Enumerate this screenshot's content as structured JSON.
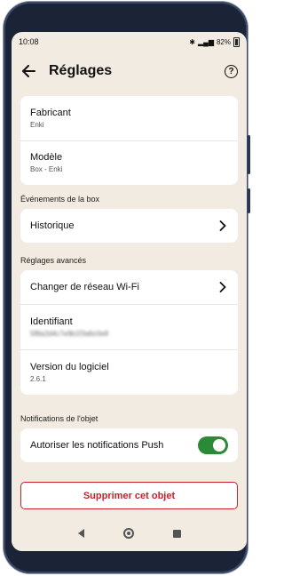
{
  "statusbar": {
    "time": "10:08",
    "battery": "82%"
  },
  "header": {
    "title": "Réglages",
    "help_label": "?"
  },
  "device_card": {
    "manufacturer_label": "Fabricant",
    "manufacturer_value": "Enki",
    "model_label": "Modèle",
    "model_value": "Box - Enki"
  },
  "events_section": {
    "title": "Événements de la box",
    "history_label": "Historique"
  },
  "advanced_section": {
    "title": "Réglages avancés",
    "wifi_label": "Changer de réseau Wi-Fi",
    "identifier_label": "Identifiant",
    "identifier_value": "5f8a2d4c7e9b1f3a6c0e8",
    "software_label": "Version du logiciel",
    "software_value": "2.6.1"
  },
  "notifications_section": {
    "title": "Notifications de l'objet",
    "push_label": "Autoriser les notifications Push",
    "push_enabled": true
  },
  "actions": {
    "delete_label": "Supprimer cet objet"
  },
  "colors": {
    "accent_green": "#2a8a36",
    "danger_red": "#c8222b",
    "background": "#f2ebe1"
  }
}
